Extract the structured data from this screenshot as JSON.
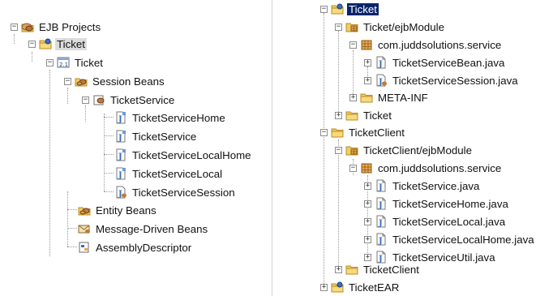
{
  "left_tree": {
    "root": {
      "label": "EJB Projects",
      "icon": "ejb-projects-icon"
    },
    "project": {
      "label": "Ticket"
    },
    "module": {
      "label": "Ticket"
    },
    "session_beans": {
      "label": "Session Beans"
    },
    "ticket_service": {
      "label": "TicketService"
    },
    "interfaces": [
      {
        "label": "TicketServiceHome"
      },
      {
        "label": "TicketService"
      },
      {
        "label": "TicketServiceLocalHome"
      },
      {
        "label": "TicketServiceLocal"
      },
      {
        "label": "TicketServiceSession"
      }
    ],
    "entity_beans": {
      "label": "Entity Beans"
    },
    "message_driven_beans": {
      "label": "Message-Driven Beans"
    },
    "assembly_descriptor": {
      "label": "AssemblyDescriptor"
    }
  },
  "right_tree": {
    "ticket": {
      "label": "Ticket"
    },
    "ticket_ejbmodule": {
      "label": "Ticket/ejbModule"
    },
    "ticket_package": {
      "label": "com.juddsolutions.service"
    },
    "ticket_files": [
      {
        "label": "TicketServiceBean.java"
      },
      {
        "label": "TicketServiceSession.java"
      }
    ],
    "meta_inf": {
      "label": "META-INF"
    },
    "ticket_folder": {
      "label": "Ticket"
    },
    "ticket_client": {
      "label": "TicketClient"
    },
    "client_ejbmodule": {
      "label": "TicketClient/ejbModule"
    },
    "client_package": {
      "label": "com.juddsolutions.service"
    },
    "client_files": [
      {
        "label": "TicketService.java"
      },
      {
        "label": "TicketServiceHome.java"
      },
      {
        "label": "TicketServiceLocal.java"
      },
      {
        "label": "TicketServiceLocalHome.java"
      },
      {
        "label": "TicketServiceUtil.java"
      }
    ],
    "client_folder": {
      "label": "TicketClient"
    },
    "ticket_ear": {
      "label": "TicketEAR"
    }
  },
  "colors": {
    "selection_grey": "#dcdcdc",
    "selection_blue": "#0a246a",
    "folder": "#e8b84a",
    "java": "#3c6fb5"
  }
}
